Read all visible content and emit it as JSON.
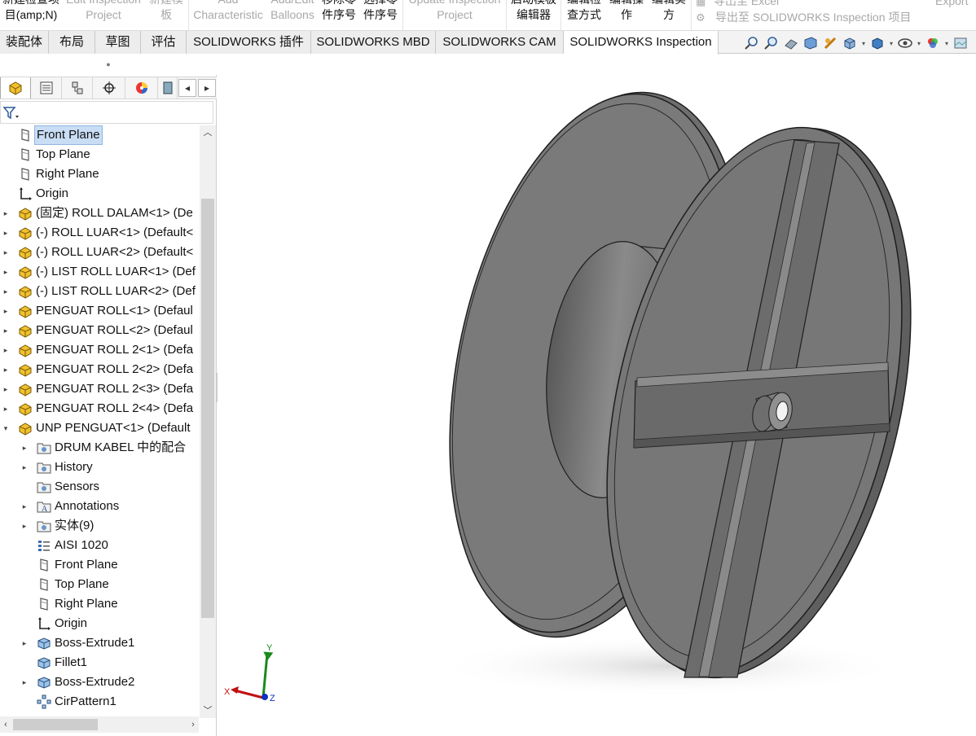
{
  "ribbon": {
    "buttons": [
      {
        "label": "新建检查项\n目(amp;N)",
        "enabled": true
      },
      {
        "label": "Edit Inspection\nProject",
        "enabled": false
      },
      {
        "label": "新建模\n板",
        "enabled": false
      },
      {
        "label": "Add\nCharacteristic",
        "enabled": false
      },
      {
        "label": "Add/Edit\nBalloons",
        "enabled": false
      },
      {
        "label": "移除零\n件序号",
        "enabled": true
      },
      {
        "label": "选择零\n件序号",
        "enabled": true
      },
      {
        "label": "Update Inspection\nProject",
        "enabled": false
      },
      {
        "label": "启动模板\n编辑器",
        "enabled": true
      },
      {
        "label": "编辑检\n查方式",
        "enabled": true
      },
      {
        "label": "编辑操\n作",
        "enabled": true
      },
      {
        "label": "编辑实\n方",
        "enabled": true
      }
    ],
    "export_items": [
      "导出至 Excel",
      "导出至 SOLIDWORKS Inspection 项目"
    ],
    "export_right": "Export"
  },
  "tabs": [
    "装配体",
    "布局",
    "草图",
    "评估",
    "SOLIDWORKS 插件",
    "SOLIDWORKS MBD",
    "SOLIDWORKS CAM",
    "SOLIDWORKS Inspection"
  ],
  "active_tab": "SOLIDWORKS Inspection",
  "fm_tabs": [
    "feature-manager",
    "property-manager",
    "configuration-manager",
    "dimxpert-manager",
    "display-manager",
    "cam-manager"
  ],
  "tree": [
    {
      "label": "Front Plane",
      "icon": "plane",
      "level": 0,
      "expander": "",
      "selected": true
    },
    {
      "label": "Top Plane",
      "icon": "plane",
      "level": 0,
      "expander": ""
    },
    {
      "label": "Right Plane",
      "icon": "plane",
      "level": 0,
      "expander": ""
    },
    {
      "label": "Origin",
      "icon": "origin",
      "level": 0,
      "expander": ""
    },
    {
      "label": "(固定) ROLL DALAM<1> (De",
      "icon": "part",
      "level": 0,
      "expander": "▸"
    },
    {
      "label": "(-) ROLL LUAR<1> (Default<",
      "icon": "part",
      "level": 0,
      "expander": "▸"
    },
    {
      "label": "(-) ROLL LUAR<2> (Default<",
      "icon": "part",
      "level": 0,
      "expander": "▸"
    },
    {
      "label": "(-) LIST ROLL LUAR<1> (Def",
      "icon": "part",
      "level": 0,
      "expander": "▸"
    },
    {
      "label": "(-) LIST ROLL LUAR<2> (Def",
      "icon": "part",
      "level": 0,
      "expander": "▸"
    },
    {
      "label": "PENGUAT ROLL<1> (Defaul",
      "icon": "part",
      "level": 0,
      "expander": "▸"
    },
    {
      "label": "PENGUAT ROLL<2> (Defaul",
      "icon": "part",
      "level": 0,
      "expander": "▸"
    },
    {
      "label": "PENGUAT ROLL 2<1> (Defa",
      "icon": "part",
      "level": 0,
      "expander": "▸"
    },
    {
      "label": "PENGUAT ROLL 2<2> (Defa",
      "icon": "part",
      "level": 0,
      "expander": "▸"
    },
    {
      "label": "PENGUAT ROLL 2<3> (Defa",
      "icon": "part",
      "level": 0,
      "expander": "▸"
    },
    {
      "label": "PENGUAT ROLL 2<4> (Defa",
      "icon": "part",
      "level": 0,
      "expander": "▸"
    },
    {
      "label": "UNP PENGUAT<1> (Default",
      "icon": "part",
      "level": 0,
      "expander": "▾"
    },
    {
      "label": "DRUM KABEL 中的配合",
      "icon": "folder",
      "level": 1,
      "expander": "▸"
    },
    {
      "label": "History",
      "icon": "folder",
      "level": 1,
      "expander": "▸"
    },
    {
      "label": "Sensors",
      "icon": "folder",
      "level": 1,
      "expander": ""
    },
    {
      "label": "Annotations",
      "icon": "annot",
      "level": 1,
      "expander": "▸"
    },
    {
      "label": "实体(9)",
      "icon": "folder",
      "level": 1,
      "expander": "▸"
    },
    {
      "label": "AISI 1020",
      "icon": "material",
      "level": 1,
      "expander": ""
    },
    {
      "label": "Front Plane",
      "icon": "plane",
      "level": 1,
      "expander": ""
    },
    {
      "label": "Top Plane",
      "icon": "plane",
      "level": 1,
      "expander": ""
    },
    {
      "label": "Right Plane",
      "icon": "plane",
      "level": 1,
      "expander": ""
    },
    {
      "label": "Origin",
      "icon": "origin",
      "level": 1,
      "expander": ""
    },
    {
      "label": "Boss-Extrude1",
      "icon": "feature",
      "level": 1,
      "expander": "▸"
    },
    {
      "label": "Fillet1",
      "icon": "feature",
      "level": 1,
      "expander": ""
    },
    {
      "label": "Boss-Extrude2",
      "icon": "feature",
      "level": 1,
      "expander": "▸"
    },
    {
      "label": "CirPattern1",
      "icon": "pattern",
      "level": 1,
      "expander": ""
    }
  ],
  "triad": {
    "x": "X",
    "y": "Y",
    "z": "Z"
  },
  "colors": {
    "part_body": "#7a7a7a",
    "part_edge": "#1e1e1e",
    "selection": "#c9def5",
    "part_icon": "#e6b800"
  }
}
